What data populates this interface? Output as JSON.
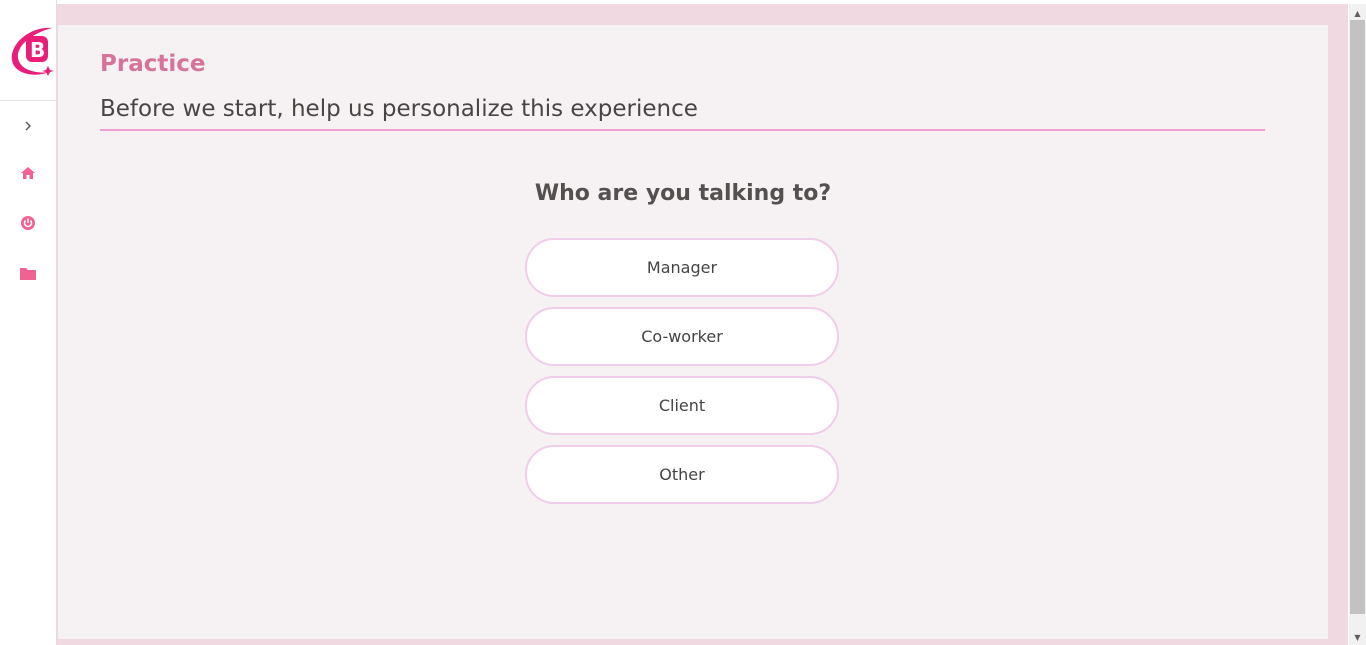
{
  "app": {
    "title": "Practice",
    "subtitle": "Before we start, help us personalize this experience"
  },
  "sidebar": {
    "items": [
      {
        "icon": "chevron-right-icon"
      },
      {
        "icon": "home-icon"
      },
      {
        "icon": "power-icon"
      },
      {
        "icon": "folder-icon"
      }
    ],
    "accent": "#f06292"
  },
  "question": {
    "text": "Who are you talking to?",
    "options": [
      "Manager",
      "Co-worker",
      "Client",
      "Other"
    ]
  },
  "colors": {
    "accent": "#d6739a",
    "underline": "#ef9fd3",
    "option_border": "#f0cdea",
    "frame": "#f1d9e1",
    "panel": "#f6f1f2"
  }
}
